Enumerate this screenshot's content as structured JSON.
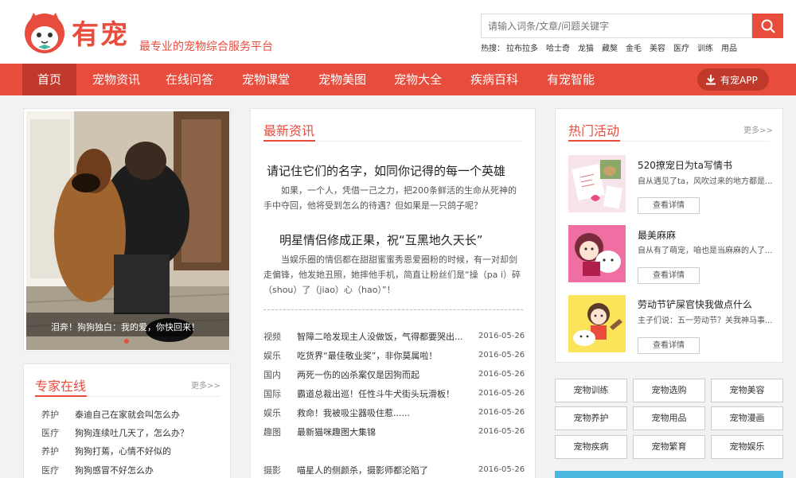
{
  "header": {
    "brand": "有宠",
    "slogan": "最专业的宠物综合服务平台",
    "search_placeholder": "请输入词条/文章/问题关键字",
    "hot_label": "热搜：",
    "hot_items": [
      "拉布拉多",
      "哈士奇",
      "龙猫",
      "藏獒",
      "金毛",
      "美容",
      "医疗",
      "训练",
      "用品"
    ]
  },
  "nav": {
    "items": [
      "首页",
      "宠物资讯",
      "在线问答",
      "宠物课堂",
      "宠物美图",
      "宠物大全",
      "疾病百科",
      "有宠智能"
    ],
    "app_button": "有宠APP"
  },
  "slider": {
    "caption": "泪奔！狗狗独白：我的爱，你快回来！"
  },
  "expert": {
    "title": "专家在线",
    "more": "更多>>",
    "items": [
      {
        "tag": "养护",
        "text": "泰迪自己在家就会叫怎么办"
      },
      {
        "tag": "医疗",
        "text": "狗狗连续吐几天了，怎么办？"
      },
      {
        "tag": "养护",
        "text": "狗狗打蔫，心情不好似的"
      },
      {
        "tag": "医疗",
        "text": "狗狗感冒不好怎么办"
      }
    ]
  },
  "news": {
    "title": "最新资讯",
    "features": [
      {
        "headline": "请记住它们的名字，如同你记得的每一个英雄",
        "summary": "如果，一个人，凭借一己之力，把200条鲜活的生命从死神的手中夺回，他将受到怎么的待遇？但如果是一只鸽子呢？"
      },
      {
        "headline": "明星情侣修成正果，祝“互黑地久天长”",
        "summary": "当娱乐圈的情侣都在甜甜蜜蜜秀恩爱圈粉的时候，有一对却剑走偏锋，他发她丑照，她摔他手机，简直让粉丝们是“操（pa i）碎（shou）了（jiao）心（hao）”！"
      }
    ],
    "items": [
      {
        "tag": "视频",
        "text": "智障二哈发现主人没做饭，气得都要哭出...",
        "date": "2016-05-26"
      },
      {
        "tag": "娱乐",
        "text": "吃货界“最佳敬业奖”，非你莫属啦！",
        "date": "2016-05-26"
      },
      {
        "tag": "国内",
        "text": "两死一伤的凶杀案仅是因狗而起",
        "date": "2016-05-26"
      },
      {
        "tag": "国际",
        "text": "霸道总裁出巡！任性斗牛犬街头玩滑板！",
        "date": "2016-05-26"
      },
      {
        "tag": "娱乐",
        "text": "救命！我被吸尘器吸住惹......",
        "date": "2016-05-26"
      },
      {
        "tag": "趣图",
        "text": "最新猫咪趣图大集锦",
        "date": "2016-05-26"
      },
      {
        "tag": "摄影",
        "text": "喵星人的侧颜杀，摄影师都沦陷了",
        "date": "2016-05-26"
      }
    ]
  },
  "activity": {
    "title": "热门活动",
    "more": "更多>>",
    "items": [
      {
        "title": "520撩宠日为ta写情书",
        "desc": "自从遇见了ta，风吹过来的地方都是...",
        "button": "查看详情"
      },
      {
        "title": "最美麻麻",
        "desc": "自从有了萌宠，咱也是当麻麻的人了...",
        "button": "查看详情"
      },
      {
        "title": "劳动节铲屎官快我做点什么",
        "desc": "主子们说：五一劳动节？关我神马事...",
        "button": "查看详情"
      }
    ]
  },
  "categories": [
    "宠物训练",
    "宠物选购",
    "宠物美容",
    "宠物养护",
    "宠物用品",
    "宠物漫画",
    "宠物疾病",
    "宠物繁育",
    "宠物娱乐"
  ],
  "colors": {
    "accent": "#e84c3d",
    "nav_active": "#c0392b",
    "bar": "#4ab7e0"
  }
}
